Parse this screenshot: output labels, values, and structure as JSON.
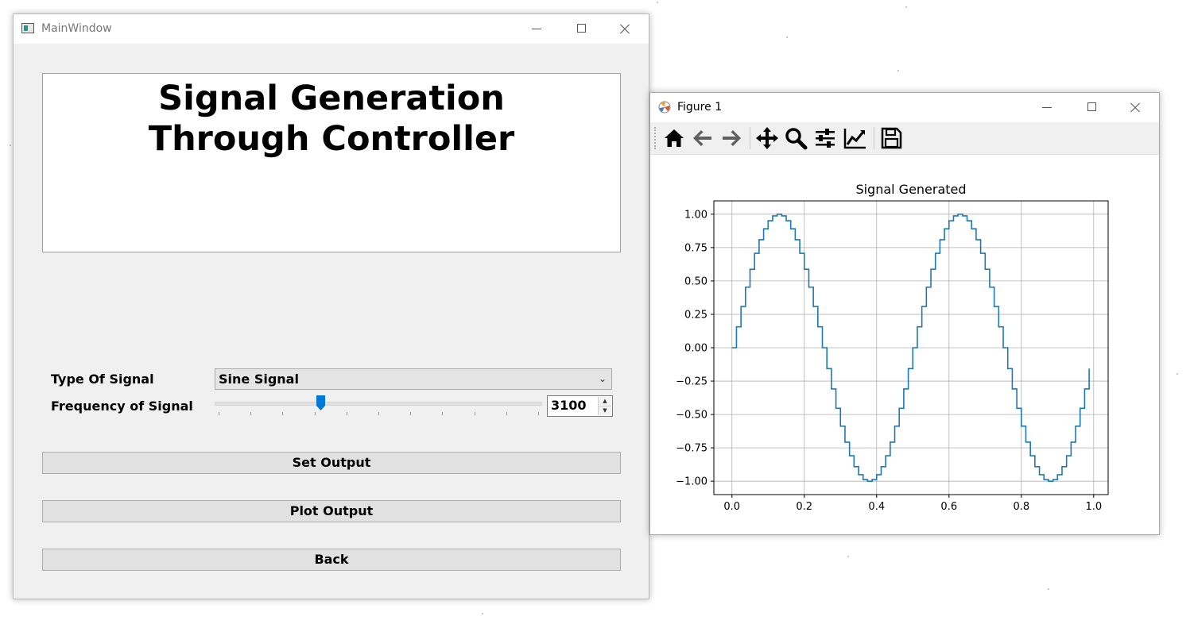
{
  "main_window": {
    "title": "MainWindow",
    "heading": "Signal Generation\nThrough Controller",
    "type_label": "Type Of Signal",
    "type_selected": "Sine Signal",
    "frequency_label": "Frequency of Signal",
    "frequency_value": "3100",
    "frequency_slider_fraction": 0.32,
    "buttons": {
      "set_output": "Set Output",
      "plot_output": "Plot Output",
      "back": "Back"
    }
  },
  "figure_window": {
    "title": "Figure 1",
    "toolbar_icons": [
      "home-icon",
      "back-arrow-icon",
      "forward-arrow-icon",
      "pan-icon",
      "zoom-icon",
      "configure-subplots-icon",
      "edit-axis-icon",
      "save-icon"
    ]
  },
  "colors": {
    "line": "#1f77b4",
    "slider_handle": "#0078d7",
    "grid": "#b0b0b0"
  },
  "chart_data": {
    "type": "line",
    "drawstyle": "steps",
    "title": "Signal Generated",
    "xlabel": "",
    "ylabel": "",
    "xlim": [
      -0.05,
      1.04
    ],
    "ylim": [
      -1.1,
      1.1
    ],
    "xticks": [
      0.0,
      0.2,
      0.4,
      0.6,
      0.8,
      1.0
    ],
    "xtick_labels": [
      "0.0",
      "0.2",
      "0.4",
      "0.6",
      "0.8",
      "1.0"
    ],
    "yticks": [
      1.0,
      0.75,
      0.5,
      0.25,
      0.0,
      -0.25,
      -0.5,
      -0.75,
      -1.0
    ],
    "ytick_labels": [
      "1.00",
      "0.75",
      "0.50",
      "0.25",
      "0.00",
      "−0.25",
      "−0.50",
      "−0.75",
      "−1.00"
    ],
    "grid": true,
    "signal": {
      "waveform": "sine",
      "frequency_hz": 2,
      "amplitude": 1,
      "sample_step": 0.0125,
      "x_start": 0.0,
      "x_end": 0.9875
    }
  }
}
